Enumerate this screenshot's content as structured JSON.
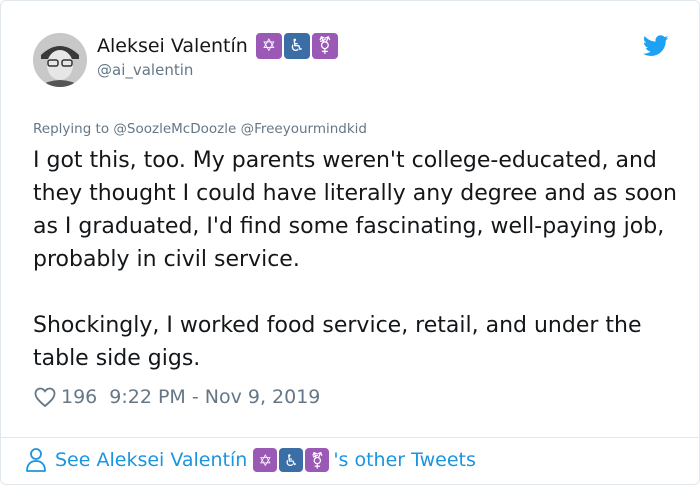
{
  "author": {
    "name": "Aleksei Valentín",
    "handle": "@ai_valentin",
    "emojis": [
      "✡",
      "♿",
      "⚧"
    ]
  },
  "reply": {
    "prefix": "Replying to",
    "mentions": [
      "@SoozleMcDoozle",
      "@Freeyourmindkid"
    ]
  },
  "tweet": {
    "paragraphs": [
      "I got this, too. My parents weren't college-educated, and they thought I could have literally any degree and as soon as I graduated, I'd find some fascinating, well-paying job, probably in civil service.",
      "Shockingly, I worked food service, retail, and under the table side gigs."
    ]
  },
  "meta": {
    "likes": "196",
    "timestamp": "9:22 PM - Nov 9, 2019"
  },
  "footer": {
    "prefix": "See Aleksei Valentín",
    "suffix": "'s other Tweets"
  },
  "colors": {
    "link": "#1b95e0",
    "secondary": "#657786",
    "emoji_purple": "#9b59b6",
    "emoji_blue": "#3b6ea5"
  },
  "icons": [
    "avatar-photo",
    "twitter-bird-icon",
    "heart-icon",
    "person-icon"
  ]
}
